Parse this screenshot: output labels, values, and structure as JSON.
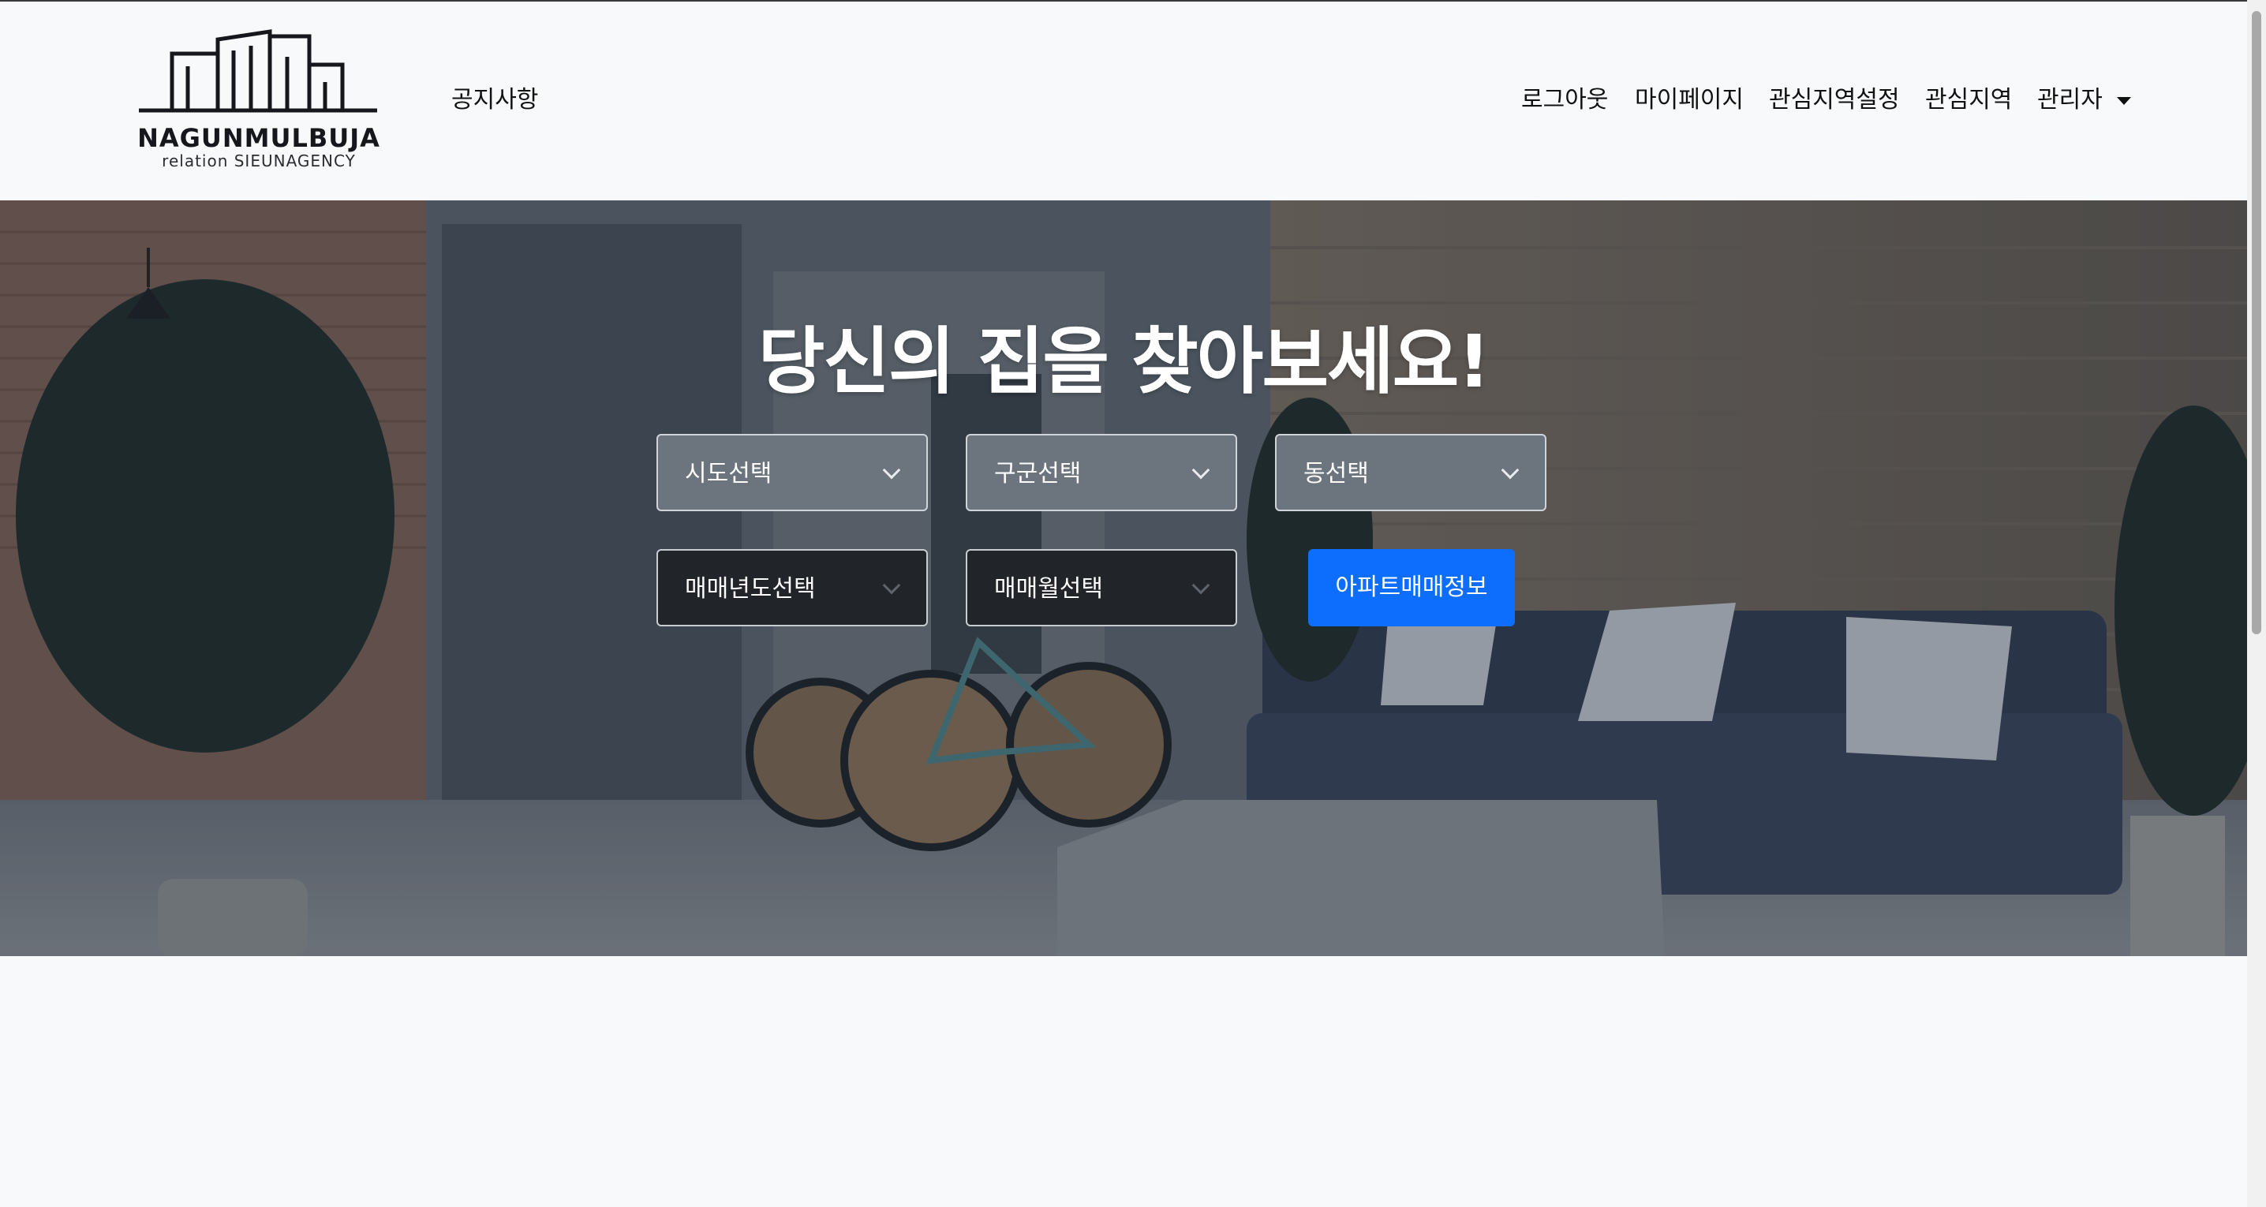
{
  "brand": {
    "name": "NAGUNMULBUJA",
    "tagline": "relation SIEUNAGENCY"
  },
  "nav": {
    "left_items": [
      {
        "label": "공지사항"
      }
    ],
    "right_items": [
      {
        "label": "로그아웃"
      },
      {
        "label": "마이페이지"
      },
      {
        "label": "관심지역설정"
      },
      {
        "label": "관심지역"
      },
      {
        "label": "관리자"
      }
    ]
  },
  "hero": {
    "title": "당신의 집을 찾아보세요!",
    "selects": {
      "sido": "시도선택",
      "gugun": "구군선택",
      "dong": "동선택",
      "year": "매매년도선택",
      "month": "매매월선택"
    },
    "search_button": "아파트매매정보"
  },
  "colors": {
    "primary": "#0d6efd",
    "select_light": "#6c757d",
    "select_dark": "#212529",
    "background": "#f8f9fa"
  },
  "icons": [
    "logo-building-icon",
    "chevron-down-icon",
    "caret-down-icon"
  ]
}
